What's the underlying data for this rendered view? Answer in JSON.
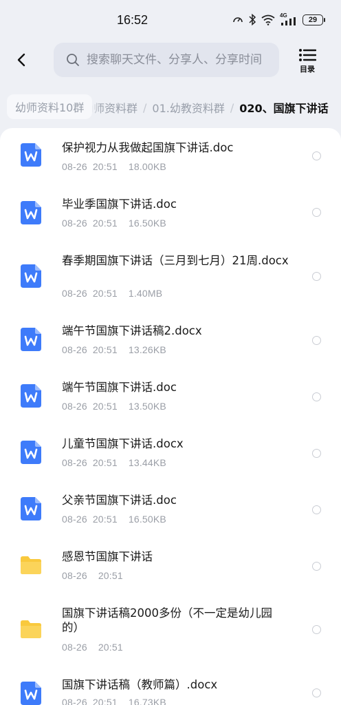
{
  "status_bar": {
    "time": "16:52",
    "network": "4G",
    "battery": "29"
  },
  "header": {
    "search_placeholder": "搜索聊天文件、分享人、分享时间",
    "toc_label": "目录"
  },
  "breadcrumb": {
    "items": [
      "幼师资料10群",
      "幼师资料群",
      "01.幼教资料群",
      "020、国旗下讲话"
    ]
  },
  "colors": {
    "doc_icon": "#3e7bfa",
    "folder_icon": "#f9c93d",
    "background": "#eef0f5"
  },
  "files": [
    {
      "type": "doc",
      "icon": "word-doc-icon",
      "name": "保护视力从我做起国旗下讲话.doc",
      "date": "08-26",
      "time": "20:51",
      "size": "18.00KB"
    },
    {
      "type": "doc",
      "icon": "word-doc-icon",
      "name": "毕业季国旗下讲话.doc",
      "date": "08-26",
      "time": "20:51",
      "size": "16.50KB"
    },
    {
      "type": "doc",
      "icon": "word-doc-icon",
      "name": "春季期国旗下讲话（三月到七月）21周.docx",
      "date": "08-26",
      "time": "20:51",
      "size": "1.40MB"
    },
    {
      "type": "doc",
      "icon": "word-doc-icon",
      "name": "端午节国旗下讲话稿2.docx",
      "date": "08-26",
      "time": "20:51",
      "size": "13.26KB"
    },
    {
      "type": "doc",
      "icon": "word-doc-icon",
      "name": "端午节国旗下讲话.doc",
      "date": "08-26",
      "time": "20:51",
      "size": "13.50KB"
    },
    {
      "type": "doc",
      "icon": "word-doc-icon",
      "name": "儿童节国旗下讲话.docx",
      "date": "08-26",
      "time": "20:51",
      "size": "13.44KB"
    },
    {
      "type": "doc",
      "icon": "word-doc-icon",
      "name": "父亲节国旗下讲话.doc",
      "date": "08-26",
      "time": "20:51",
      "size": "16.50KB"
    },
    {
      "type": "folder",
      "icon": "folder-icon",
      "name": "感恩节国旗下讲话",
      "date": "08-26",
      "time": "20:51",
      "size": ""
    },
    {
      "type": "folder",
      "icon": "folder-icon",
      "name": "国旗下讲话稿2000多份（不一定是幼儿园的）",
      "date": "08-26",
      "time": "20:51",
      "size": ""
    },
    {
      "type": "doc",
      "icon": "word-doc-icon",
      "name": "国旗下讲话稿（教师篇）.docx",
      "date": "08-26",
      "time": "20:51",
      "size": "16.73KB"
    }
  ]
}
